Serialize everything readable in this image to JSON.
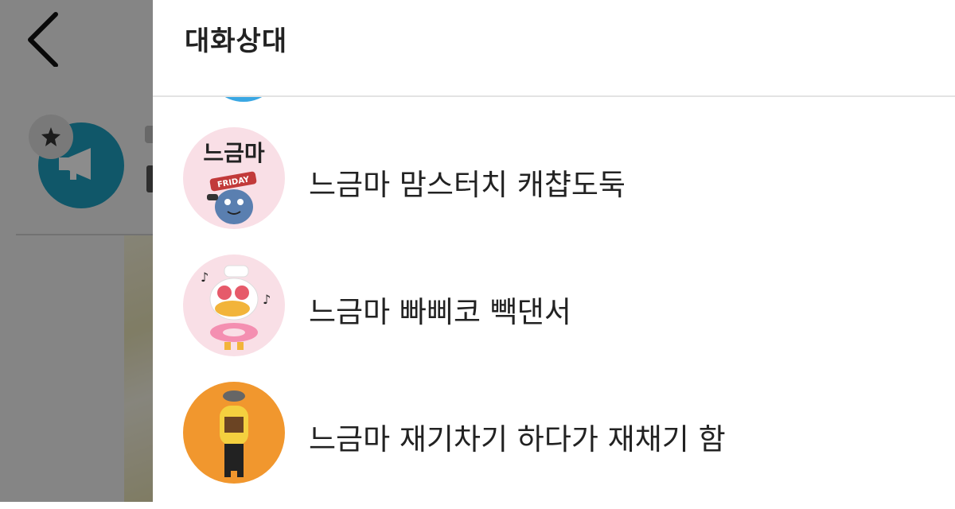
{
  "panel": {
    "title": "대화상대"
  },
  "members": [
    {
      "name": "느금마 맘스터치 캐챱도둑",
      "avatar_text": "느금마",
      "avatar_badge": "FRIDAY",
      "avatar_color": "#f9dfe6"
    },
    {
      "name": "느금마 빠삐코 빽댄서",
      "avatar_color": "#f9dfe6"
    },
    {
      "name": "느금마 재기차기 하다가 재채기 함",
      "avatar_color": "#f1972e"
    }
  ],
  "colors": {
    "overlay": "rgba(0,0,0,0.45)",
    "channel_avatar": "#1e9ec0",
    "peek_avatar": "#3aa7e3",
    "divider": "#e3e3e3"
  }
}
